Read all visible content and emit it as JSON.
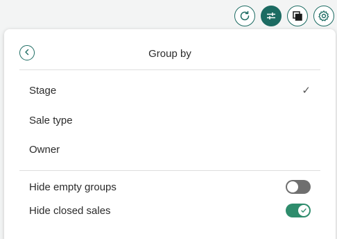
{
  "toolbar": {
    "buttons": [
      {
        "icon": "refresh-icon",
        "active": false
      },
      {
        "icon": "sliders-icon",
        "active": true
      },
      {
        "icon": "layers-icon",
        "active": false
      },
      {
        "icon": "gear-icon",
        "active": false
      }
    ]
  },
  "panel": {
    "title": "Group by",
    "back_icon": "chevron-left-icon",
    "group_options": [
      {
        "label": "Stage",
        "selected": true
      },
      {
        "label": "Sale type",
        "selected": false
      },
      {
        "label": "Owner",
        "selected": false
      }
    ],
    "toggles": [
      {
        "label": "Hide empty groups",
        "on": false
      },
      {
        "label": "Hide closed sales",
        "on": true
      }
    ],
    "check_glyph": "✓"
  },
  "colors": {
    "accent": "#1c6b62",
    "toggle_on": "#2e8c6c",
    "toggle_off": "#6f6f6f"
  }
}
